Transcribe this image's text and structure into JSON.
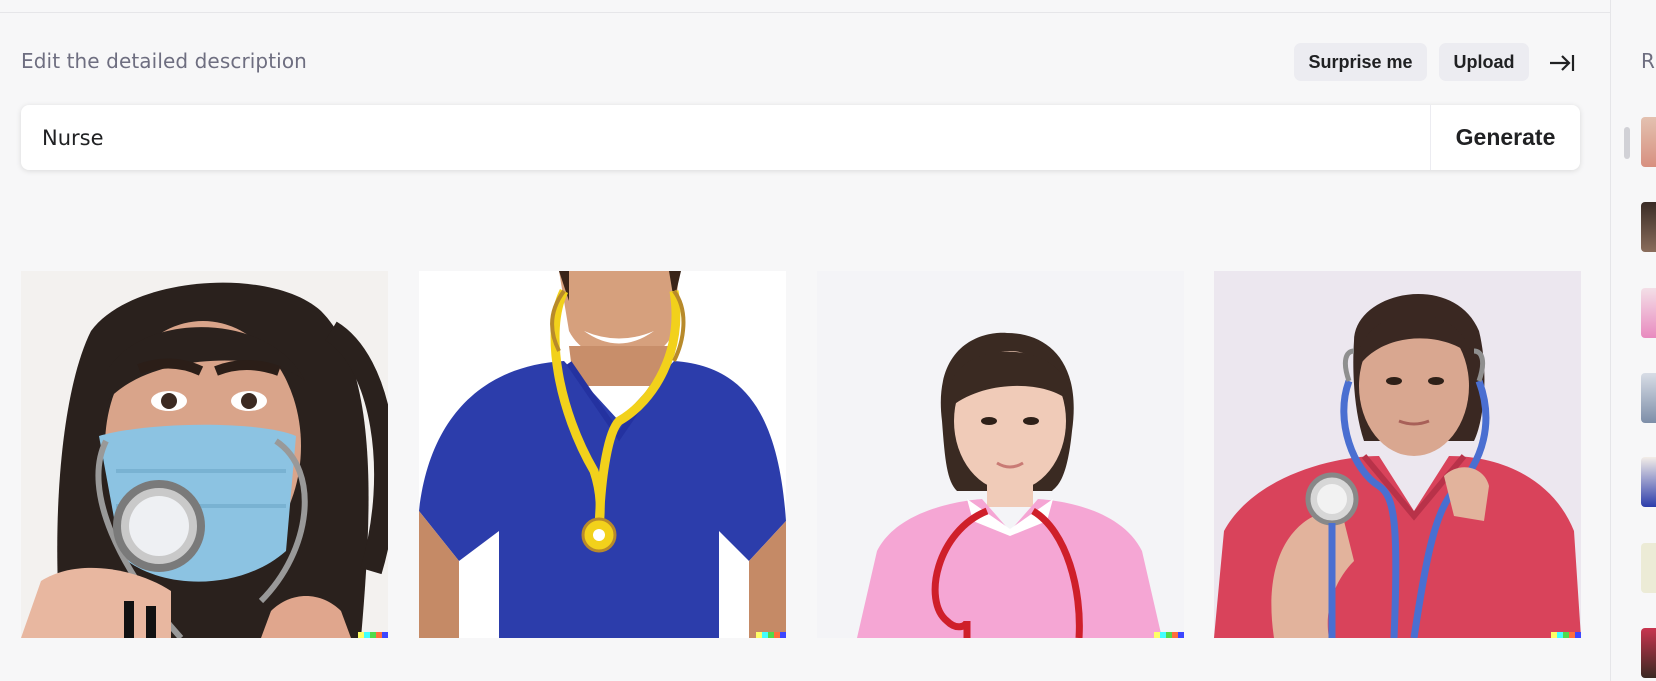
{
  "editor": {
    "label": "Edit the detailed description",
    "surprise_label": "Surprise me",
    "upload_label": "Upload",
    "collapse_icon": "arrow-to-right-icon",
    "prompt_value": "Nurse",
    "generate_label": "Generate"
  },
  "results": [
    {
      "subject": "masked nurse with stethoscope"
    },
    {
      "subject": "smiling man in blue scrubs with yellow stethoscope"
    },
    {
      "subject": "nurse in pink uniform with red stethoscope"
    },
    {
      "subject": "woman in red scrubs holding stethoscope"
    }
  ],
  "history_panel": {
    "label": "R"
  },
  "colors": {
    "background": "#f7f7f8",
    "pill": "#ececf1",
    "text": "#202123",
    "muted": "#6e6e80",
    "signature": [
      "#ffff66",
      "#42ffff",
      "#51da4c",
      "#ff6e3c",
      "#3c46ff"
    ]
  }
}
